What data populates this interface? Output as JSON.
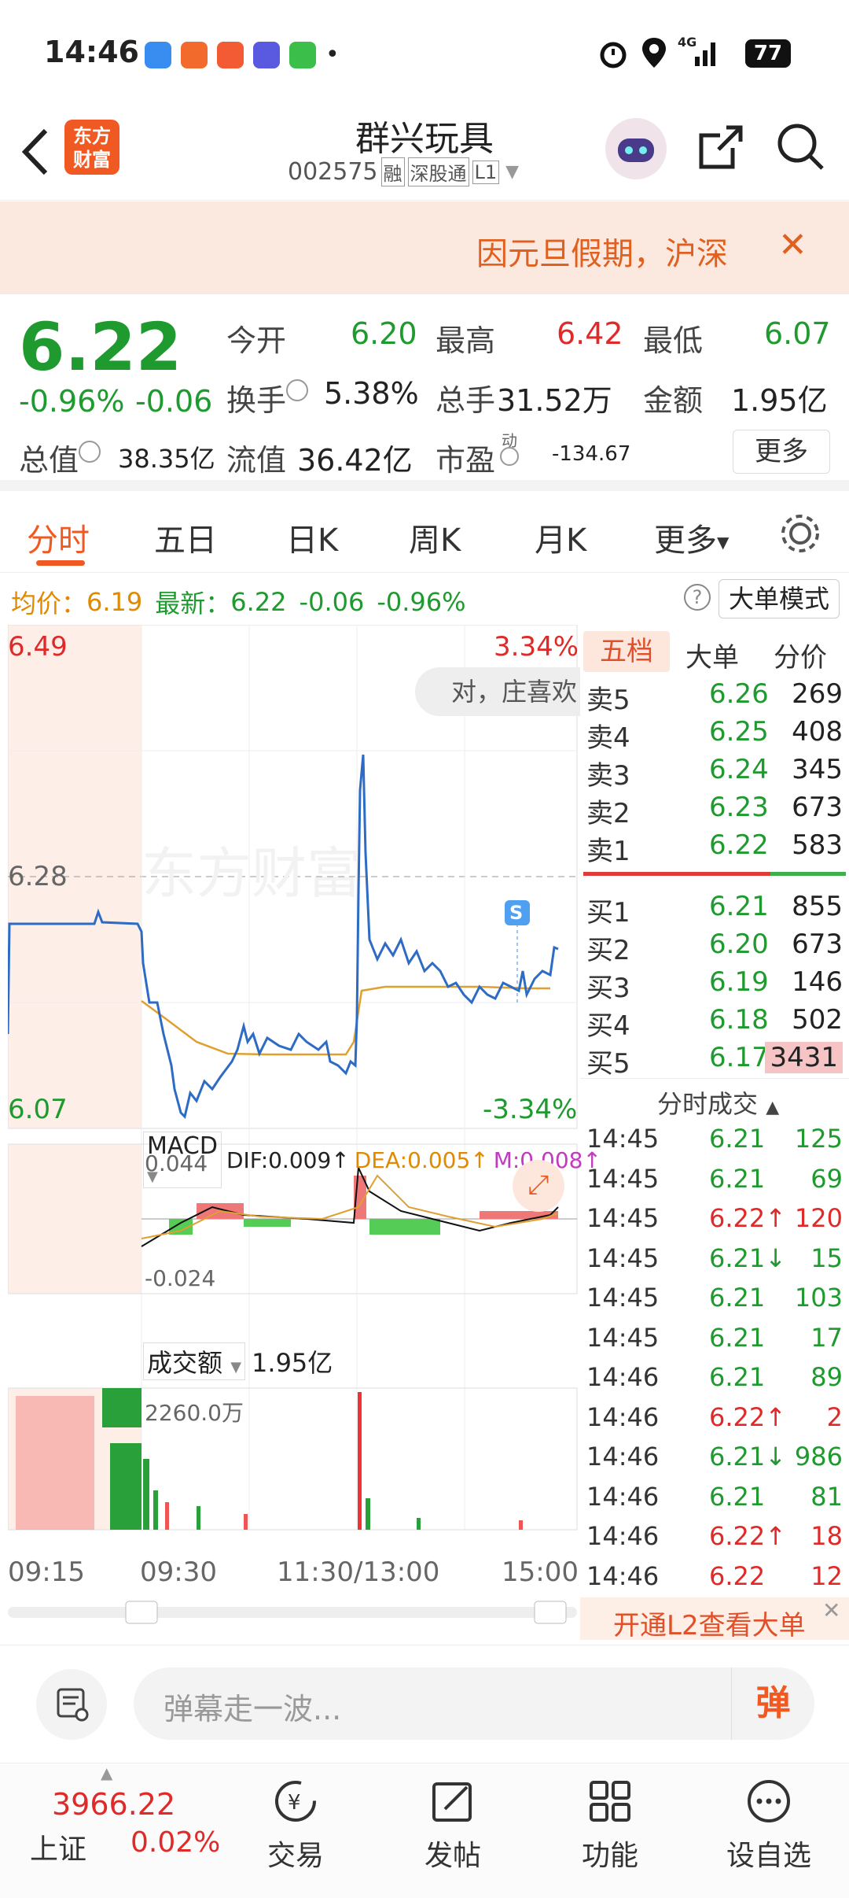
{
  "status": {
    "time": "14:46",
    "dot": "•",
    "network": "4G",
    "battery": "77"
  },
  "header": {
    "logo_line1": "东方",
    "logo_line2": "财富",
    "title": "群兴玩具",
    "code": "002575",
    "tags": [
      "融",
      "深股通",
      "L1"
    ]
  },
  "banner": {
    "text": "因元旦假期，沪深",
    "close": "✕"
  },
  "quote": {
    "price": "6.22",
    "change_pct": "-0.96%",
    "change": "-0.06",
    "open_label": "今开",
    "open": "6.20",
    "high_label": "最高",
    "high": "6.42",
    "low_label": "最低",
    "low": "6.07",
    "turnover_label": "换手",
    "turnover": "5.38%",
    "volume_label": "总手",
    "volume": "31.52万",
    "amount_label": "金额",
    "amount": "1.95亿",
    "mcap_label": "总值",
    "mcap": "38.35亿",
    "float_label": "流值",
    "float": "36.42亿",
    "pe_label": "市盈",
    "pe_sup": "动",
    "pe": "-134.67",
    "more": "更多"
  },
  "tabs": [
    "分时",
    "五日",
    "日K",
    "周K",
    "月K",
    "更多"
  ],
  "info": {
    "avg_label": "均价：",
    "avg": "6.19",
    "latest_label": "最新：",
    "latest": "6.22",
    "chg": "-0.06",
    "pct": "-0.96%",
    "mode_btn": "大单模式"
  },
  "chart": {
    "top_price": "6.49",
    "top_pct": "3.34%",
    "mid_price": "6.28",
    "bottom_price": "6.07",
    "bottom_pct": "-3.34%",
    "watermark": "东方财富",
    "danmu": "对，庄喜欢",
    "s_marker": "S",
    "macd_label": "MACD",
    "dif": "DIF:0.009↑",
    "dea": "DEA:0.005↑",
    "m": "M:0.008↑",
    "macd_top": "0.044",
    "macd_bottom": "-0.024",
    "vol_label": "成交额",
    "vol_total": "1.95亿",
    "vol_max": "2260.0万",
    "times": [
      "09:15",
      "09:30",
      "11:30/13:00",
      "15:00"
    ]
  },
  "book": {
    "tabs": [
      "五档",
      "大单",
      "分价"
    ],
    "asks": [
      {
        "l": "卖5",
        "p": "6.26",
        "v": "269"
      },
      {
        "l": "卖4",
        "p": "6.25",
        "v": "408"
      },
      {
        "l": "卖3",
        "p": "6.24",
        "v": "345"
      },
      {
        "l": "卖2",
        "p": "6.23",
        "v": "673"
      },
      {
        "l": "卖1",
        "p": "6.22",
        "v": "583"
      }
    ],
    "bids": [
      {
        "l": "买1",
        "p": "6.21",
        "v": "855"
      },
      {
        "l": "买2",
        "p": "6.20",
        "v": "673"
      },
      {
        "l": "买3",
        "p": "6.19",
        "v": "146"
      },
      {
        "l": "买4",
        "p": "6.18",
        "v": "502"
      },
      {
        "l": "买5",
        "p": "6.17",
        "v": "3431"
      }
    ],
    "trades_title": "分时成交",
    "trades": [
      {
        "t": "14:45",
        "p": "6.21",
        "a": "",
        "v": "125",
        "c": "green"
      },
      {
        "t": "14:45",
        "p": "6.21",
        "a": "",
        "v": "69",
        "c": "green"
      },
      {
        "t": "14:45",
        "p": "6.22",
        "a": "↑",
        "v": "120",
        "c": "red"
      },
      {
        "t": "14:45",
        "p": "6.21",
        "a": "↓",
        "v": "15",
        "c": "green"
      },
      {
        "t": "14:45",
        "p": "6.21",
        "a": "",
        "v": "103",
        "c": "green"
      },
      {
        "t": "14:45",
        "p": "6.21",
        "a": "",
        "v": "17",
        "c": "green"
      },
      {
        "t": "14:46",
        "p": "6.21",
        "a": "",
        "v": "89",
        "c": "green"
      },
      {
        "t": "14:46",
        "p": "6.22",
        "a": "↑",
        "v": "2",
        "c": "red"
      },
      {
        "t": "14:46",
        "p": "6.21",
        "a": "↓",
        "v": "986",
        "c": "green"
      },
      {
        "t": "14:46",
        "p": "6.21",
        "a": "",
        "v": "81",
        "c": "green"
      },
      {
        "t": "14:46",
        "p": "6.22",
        "a": "↑",
        "v": "18",
        "c": "red"
      },
      {
        "t": "14:46",
        "p": "6.22",
        "a": "",
        "v": "12",
        "c": "red"
      }
    ],
    "l2": "开通L2查看大单"
  },
  "danmu": {
    "placeholder": "弹幕走一波...",
    "btn": "弹"
  },
  "bottom": {
    "index_value": "3966.22",
    "index_name": "上证",
    "index_pct": "0.02%",
    "nav": [
      "交易",
      "发帖",
      "功能",
      "设自选"
    ]
  }
}
